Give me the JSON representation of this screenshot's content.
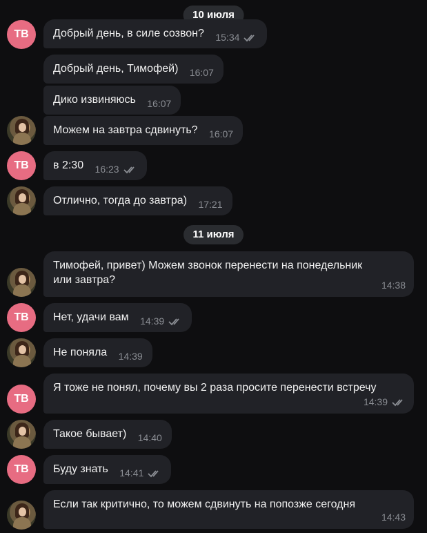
{
  "date_separators": [
    "10 июля",
    "11 июля"
  ],
  "avatars": {
    "tb_initials": "ТВ"
  },
  "messages": [
    {
      "text": "Добрый день, в силе созвон?",
      "time": "15:34",
      "read": true,
      "sender": "tb"
    },
    {
      "text": "Добрый день, Тимофей)",
      "time": "16:07",
      "read": false,
      "sender": "other"
    },
    {
      "text": "Дико извиняюсь",
      "time": "16:07",
      "read": false,
      "sender": "other"
    },
    {
      "text": "Можем на завтра сдвинуть?",
      "time": "16:07",
      "read": false,
      "sender": "other"
    },
    {
      "text": "в 2:30",
      "time": "16:23",
      "read": true,
      "sender": "tb"
    },
    {
      "text": "Отлично, тогда до завтра)",
      "time": "17:21",
      "read": false,
      "sender": "other"
    },
    {
      "text": "Тимофей, привет) Можем звонок перенести на понедельник или завтра?",
      "time": "14:38",
      "read": false,
      "sender": "other"
    },
    {
      "text": "Нет, удачи вам",
      "time": "14:39",
      "read": true,
      "sender": "tb"
    },
    {
      "text": "Не поняла",
      "time": "14:39",
      "read": false,
      "sender": "other"
    },
    {
      "text": "Я тоже не понял, почему вы 2 раза просите перенести встречу",
      "time": "14:39",
      "read": true,
      "sender": "tb"
    },
    {
      "text": "Такое бывает)",
      "time": "14:40",
      "read": false,
      "sender": "other"
    },
    {
      "text": "Буду знать",
      "time": "14:41",
      "read": true,
      "sender": "tb"
    },
    {
      "text": "Если так критично, то можем сдвинуть на попозже сегодня",
      "time": "14:43",
      "read": false,
      "sender": "other"
    }
  ],
  "colors": {
    "background": "#0e0e10",
    "bubble": "#212227",
    "tb_avatar": "#e76c82",
    "meta": "#8a8d93"
  }
}
